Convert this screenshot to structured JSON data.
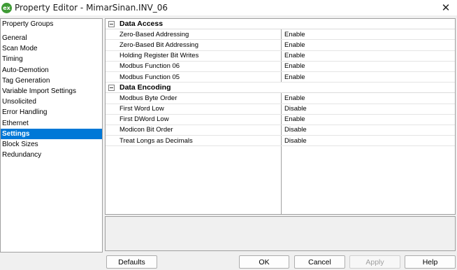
{
  "window": {
    "icon_text": "ex",
    "title": "Property Editor - MimarSinan.INV_06",
    "close_glyph": "✕"
  },
  "left_panel": {
    "header": "Property Groups",
    "items": [
      {
        "label": "General"
      },
      {
        "label": "Scan Mode"
      },
      {
        "label": "Timing"
      },
      {
        "label": "Auto-Demotion"
      },
      {
        "label": "Tag Generation"
      },
      {
        "label": "Variable Import Settings"
      },
      {
        "label": "Unsolicited"
      },
      {
        "label": "Error Handling"
      },
      {
        "label": "Ethernet"
      },
      {
        "label": "Settings",
        "selected": true
      },
      {
        "label": "Block Sizes"
      },
      {
        "label": "Redundancy"
      }
    ]
  },
  "grid": {
    "categories": [
      {
        "label": "Data Access",
        "properties": [
          {
            "name": "Zero-Based Addressing",
            "value": "Enable"
          },
          {
            "name": "Zero-Based Bit Addressing",
            "value": "Enable"
          },
          {
            "name": "Holding Register Bit Writes",
            "value": "Enable"
          },
          {
            "name": "Modbus Function 06",
            "value": "Enable"
          },
          {
            "name": "Modbus Function 05",
            "value": "Enable"
          }
        ]
      },
      {
        "label": "Data Encoding",
        "properties": [
          {
            "name": "Modbus Byte Order",
            "value": "Enable"
          },
          {
            "name": "First Word Low",
            "value": "Disable"
          },
          {
            "name": "First DWord Low",
            "value": "Enable"
          },
          {
            "name": "Modicon Bit Order",
            "value": "Disable"
          },
          {
            "name": "Treat Longs as Decimals",
            "value": "Disable"
          }
        ]
      }
    ]
  },
  "buttons": {
    "defaults": "Defaults",
    "ok": "OK",
    "cancel": "Cancel",
    "apply": "Apply",
    "help": "Help"
  },
  "colors": {
    "selection": "#0078d7",
    "app_icon": "#3e9b35"
  }
}
